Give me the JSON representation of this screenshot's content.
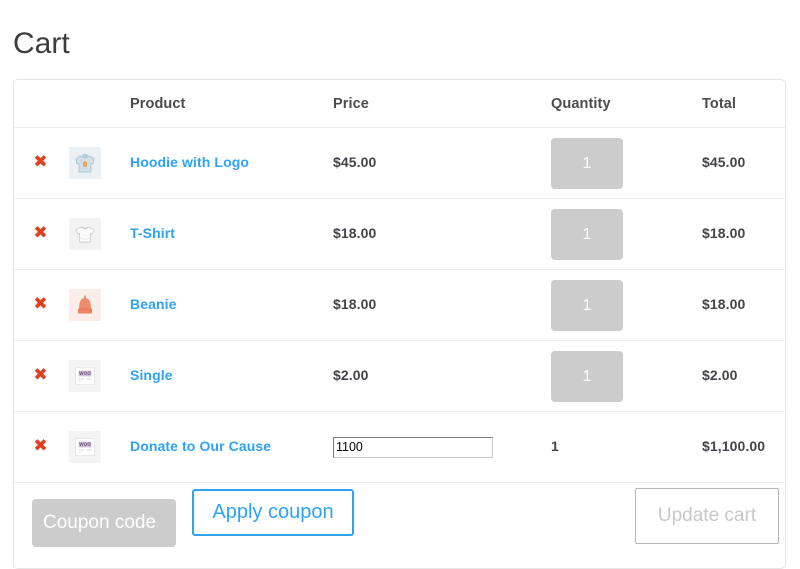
{
  "page": {
    "title": "Cart"
  },
  "table": {
    "headers": {
      "remove": "",
      "thumbnail": "",
      "product": "Product",
      "price": "Price",
      "quantity": "Quantity",
      "total": "Total"
    },
    "remove_icon_glyph": "✖",
    "rows": [
      {
        "remove_label": "Remove Hoodie with Logo from cart",
        "thumb_icon": "hoodie-thumbnail",
        "name": "Hoodie with Logo",
        "price": "$45.00",
        "quantity": "1",
        "quantity_type": "disabled-box",
        "total": "$45.00"
      },
      {
        "remove_label": "Remove T-Shirt from cart",
        "thumb_icon": "tshirt-thumbnail",
        "name": "T-Shirt",
        "price": "$18.00",
        "quantity": "1",
        "quantity_type": "disabled-box",
        "total": "$18.00"
      },
      {
        "remove_label": "Remove Beanie from cart",
        "thumb_icon": "beanie-thumbnail",
        "name": "Beanie",
        "price": "$18.00",
        "quantity": "1",
        "quantity_type": "disabled-box",
        "total": "$18.00"
      },
      {
        "remove_label": "Remove Single from cart",
        "thumb_icon": "album-thumbnail",
        "name": "Single",
        "price": "$2.00",
        "quantity": "1",
        "quantity_type": "disabled-box",
        "total": "$2.00"
      },
      {
        "remove_label": "Remove Donate to Our Cause from cart",
        "thumb_icon": "album-thumbnail",
        "name": "Donate to Our Cause",
        "price": "1100",
        "price_placeholder": "",
        "quantity": "1",
        "quantity_type": "plain-text",
        "total": "$1,100.00"
      }
    ]
  },
  "actions": {
    "coupon_placeholder": "Coupon code",
    "coupon_value": "",
    "apply_coupon_label": "Apply coupon",
    "update_cart_label": "Update cart"
  },
  "colors": {
    "link": "#2ea3f2",
    "remove": "#e2401c",
    "text": "#43454b",
    "disabled_bg": "#cccccc",
    "border": "#e6e6e6"
  }
}
